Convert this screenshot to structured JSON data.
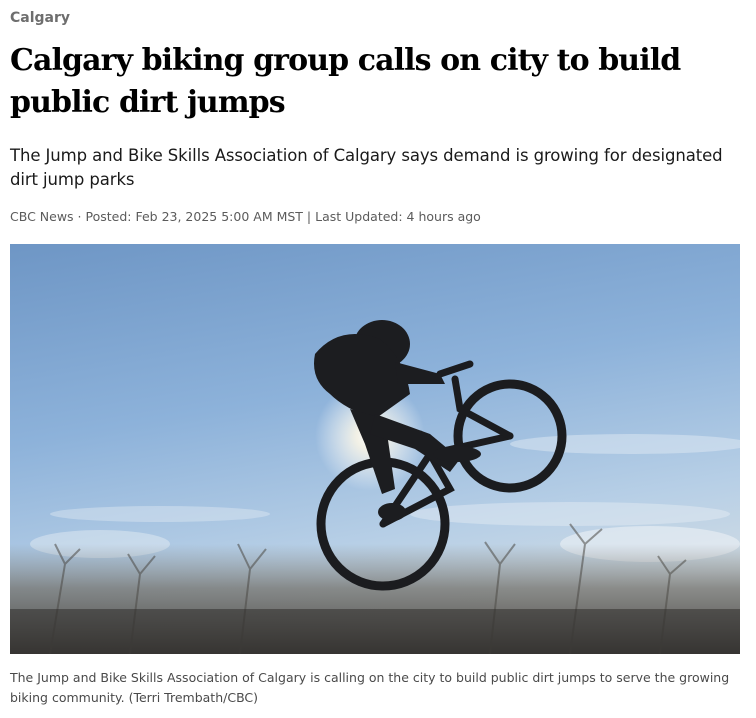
{
  "article": {
    "section": "Calgary",
    "headline": "Calgary biking group calls on city to build public dirt jumps",
    "deck": "The Jump and Bike Skills Association of Calgary says demand is growing for designated dirt jump parks",
    "byline": {
      "source": "CBC News",
      "separator": "·",
      "posted": "Posted: Feb 23, 2025 5:00 AM MST",
      "divider": "|",
      "updated": "Last Updated: 4 hours ago"
    },
    "photo": {
      "caption": "The Jump and Bike Skills Association of Calgary is calling on the city to build public dirt jumps to serve the growing biking community. (Terri Trembath/CBC)"
    }
  },
  "colors": {
    "section_link": "#6e6e6e",
    "headline": "#000000",
    "meta_text": "#5b5b5b",
    "sky_top": "#6f97c4",
    "sky_bottom": "#c9dcec"
  }
}
